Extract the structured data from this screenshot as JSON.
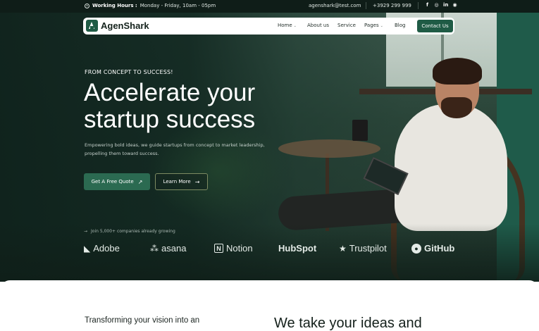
{
  "topbar": {
    "hours_label": "Working Hours :",
    "hours_value": "Monday - Friday, 10am - 05pm",
    "email": "agenshark@test.com",
    "phone": "+3929 299 999",
    "socials": [
      {
        "name": "facebook-icon",
        "glyph": "f"
      },
      {
        "name": "instagram-icon",
        "glyph": "◎"
      },
      {
        "name": "linkedin-icon",
        "glyph": "in"
      },
      {
        "name": "dribbble-icon",
        "glyph": "◉"
      }
    ]
  },
  "brand": {
    "name": "AgenShark",
    "accent": "#1f5b45"
  },
  "nav": {
    "items": [
      {
        "label": "Home",
        "has_caret": true
      },
      {
        "label": "About us",
        "has_caret": false
      },
      {
        "label": "Service",
        "has_caret": false
      },
      {
        "label": "Pages",
        "has_caret": true
      },
      {
        "label": "Blog",
        "has_caret": false
      }
    ],
    "cta": "Contact Us"
  },
  "hero": {
    "kicker": "FROM CONCEPT TO SUCCESS!",
    "headline_line1": "Accelerate your",
    "headline_line2": "startup success",
    "subtext_line1": "Empowering bold ideas, we guide startups from concept to market leadership,",
    "subtext_line2": "propelling them toward success.",
    "primary_button": "Get A Free Quote",
    "secondary_button": "Learn More",
    "social_proof": "Join 5,000+ companies already growing"
  },
  "partner_logos": [
    {
      "name": "Adobe",
      "glyph": "◣"
    },
    {
      "name": "asana",
      "glyph": "⁂"
    },
    {
      "name": "Notion",
      "glyph": "N"
    },
    {
      "name": "HubSpot",
      "glyph": ""
    },
    {
      "name": "Trustpilot",
      "glyph": "★"
    },
    {
      "name": "GitHub",
      "glyph": "●"
    }
  ],
  "section": {
    "left_heading": "Transforming your vision into an",
    "right_heading": "We take your ideas and"
  }
}
